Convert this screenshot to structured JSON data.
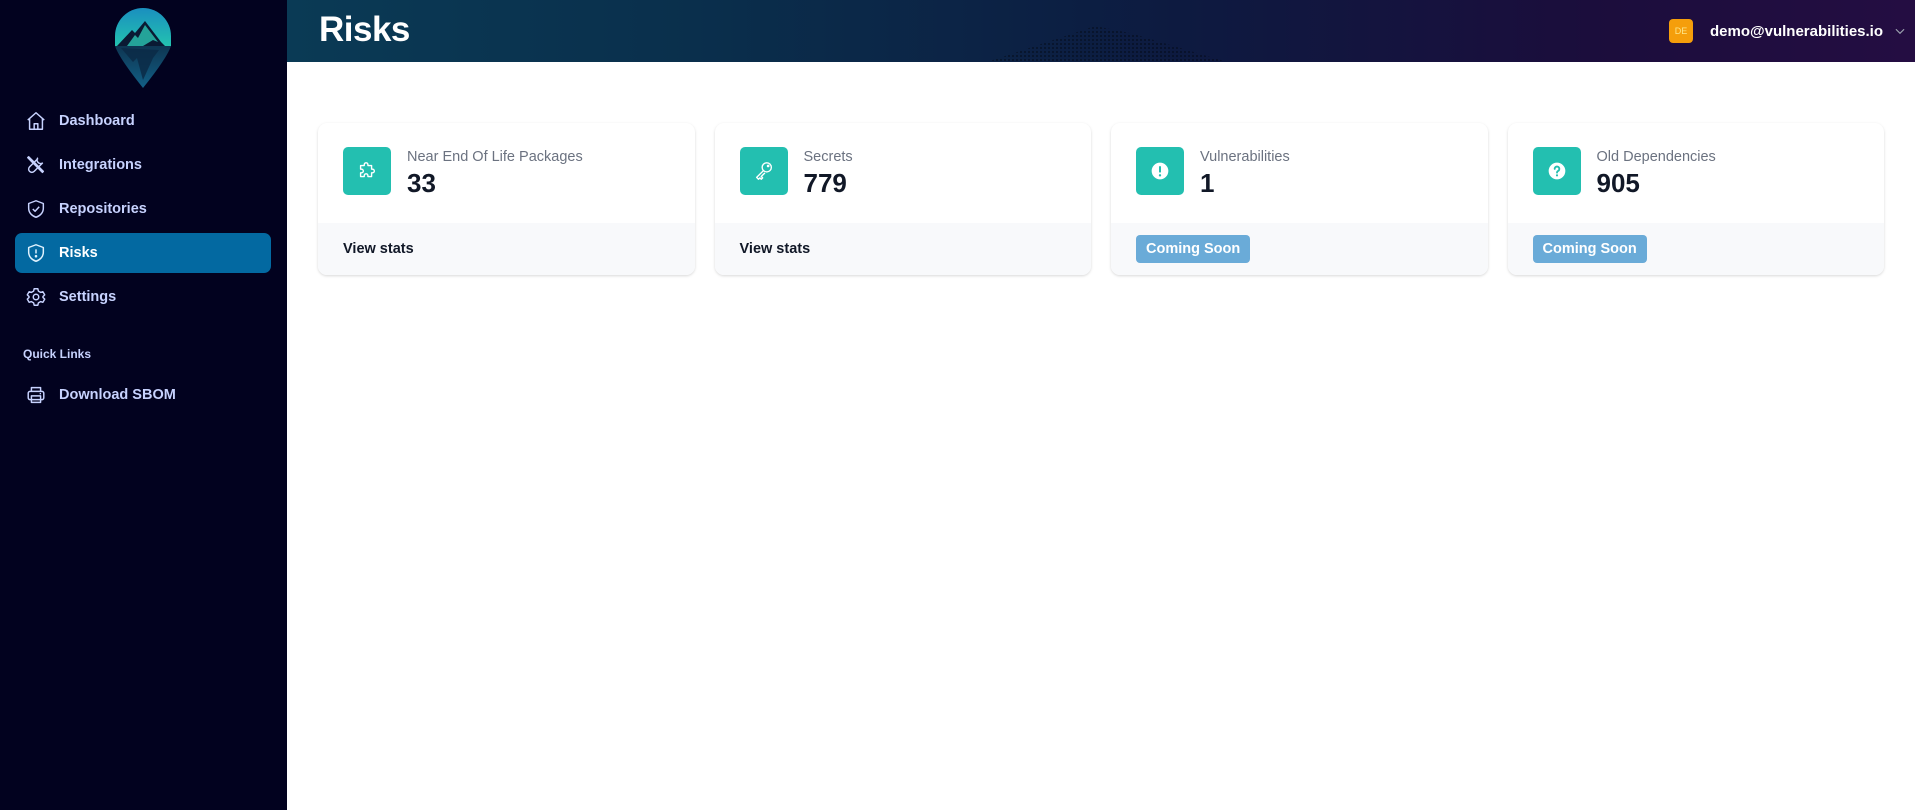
{
  "sidebar": {
    "logo": "mountain-pin-logo",
    "nav": [
      {
        "label": "Dashboard",
        "icon": "home-icon",
        "active": false
      },
      {
        "label": "Integrations",
        "icon": "tools-icon",
        "active": false
      },
      {
        "label": "Repositories",
        "icon": "shield-check-icon",
        "active": false
      },
      {
        "label": "Risks",
        "icon": "shield-exclamation-icon",
        "active": true
      },
      {
        "label": "Settings",
        "icon": "gear-icon",
        "active": false
      }
    ],
    "quick_links_title": "Quick Links",
    "quick_links": [
      {
        "label": "Download SBOM",
        "icon": "printer-icon"
      }
    ]
  },
  "header": {
    "title": "Risks",
    "user": {
      "initials": "DE",
      "email": "demo@vulnerabilities.io"
    }
  },
  "cards": [
    {
      "label": "Near End Of Life Packages",
      "value": "33",
      "icon": "puzzle-icon",
      "action": "View stats",
      "action_type": "link"
    },
    {
      "label": "Secrets",
      "value": "779",
      "icon": "key-icon",
      "action": "View stats",
      "action_type": "link"
    },
    {
      "label": "Vulnerabilities",
      "value": "1",
      "icon": "exclamation-circle-icon",
      "action": "Coming Soon",
      "action_type": "badge"
    },
    {
      "label": "Old Dependencies",
      "value": "905",
      "icon": "question-circle-icon",
      "action": "Coming Soon",
      "action_type": "badge"
    }
  ],
  "colors": {
    "sidebar_bg": "#02021f",
    "active_nav": "#0369a1",
    "card_icon_bg": "#23bfb0",
    "coming_soon_bg": "#6aabd8",
    "avatar_bg": "#f59e0b"
  }
}
